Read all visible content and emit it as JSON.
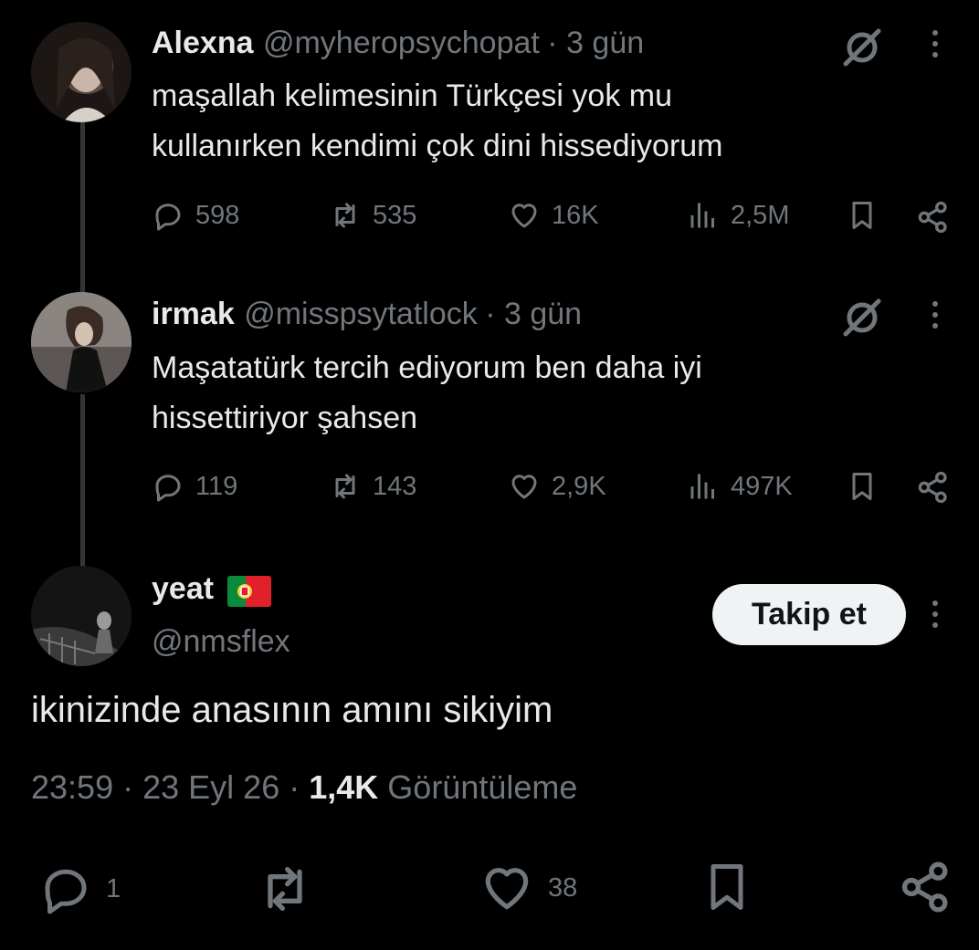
{
  "tweets": [
    {
      "name": "Alexna",
      "handle": "@myheropsychopat",
      "time": "· 3 gün",
      "text_lines": [
        "maşallah kelimesinin Türkçesi yok mu",
        "kullanırken kendimi çok dini hissediyorum"
      ],
      "replies": "598",
      "reposts": "535",
      "likes": "16K",
      "views": "2,5M"
    },
    {
      "name": "irmak",
      "handle": "@misspsytatlock",
      "time": "· 3 gün",
      "text_lines": [
        "Maşatatürk tercih ediyorum ben daha iyi",
        "hissettiriyor şahsen"
      ],
      "replies": "119",
      "reposts": "143",
      "likes": "2,9K",
      "views": "497K"
    }
  ],
  "main_tweet": {
    "name": "yeat",
    "handle": "@nmsflex",
    "flag_icon": "portugal-flag-icon",
    "follow_label": "Takip et",
    "text": "ikinizinde anasının amını sikiyim",
    "time": "23:59",
    "date": "23 Eyl 26",
    "view_count": "1,4K",
    "view_label": "Görüntüleme",
    "replies": "1",
    "likes": "38"
  },
  "colors": {
    "background": "#000000",
    "text_primary": "#e7e9ea",
    "text_secondary": "#71767b",
    "follow_button_bg": "#eff3f4",
    "thread_line": "#333639"
  }
}
